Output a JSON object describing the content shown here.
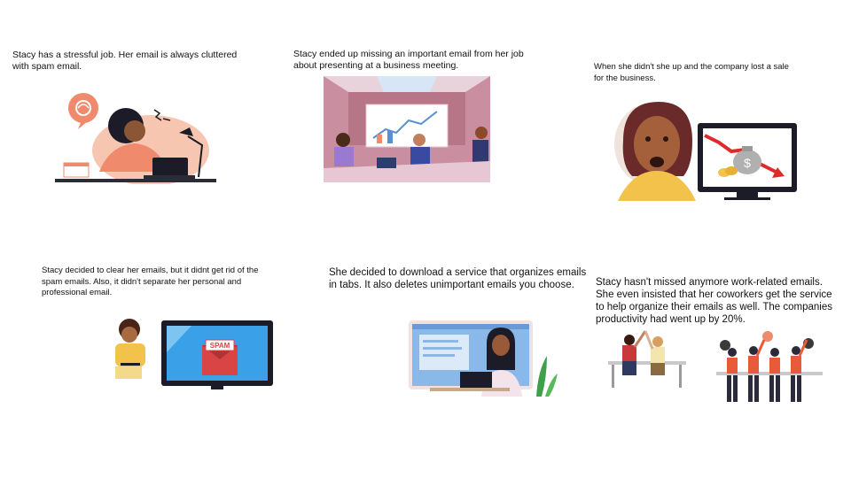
{
  "panels": [
    {
      "caption": "Stacy has a stressful job. Her email is always cluttered with spam email."
    },
    {
      "caption": "Stacy ended up missing an important email from her job about presenting at a business meeting."
    },
    {
      "caption": "When she didn't she up and the company lost a sale for the business."
    },
    {
      "caption": "Stacy decided to clear her emails, but it didnt get rid of the spam emails. Also, it didn't separate her personal and professional email."
    },
    {
      "caption": "She decided to download a service that organizes emails in tabs. It also deletes unimportant emails you choose."
    },
    {
      "caption": "Stacy hasn't missed anymore work-related emails. She even insisted that her coworkers get the service to help organize their emails as well. The companies productivity had went up by 20%."
    }
  ],
  "art_text": {
    "spam_label": "SPAM",
    "dollar_sign": "$"
  },
  "colors": {
    "peach": "#f6c6b0",
    "coral": "#f08a6c",
    "screen_blue": "#3aa0e8",
    "dark": "#1c1c28",
    "red_arrow": "#e02a2a",
    "envelope_red": "#d94545"
  }
}
